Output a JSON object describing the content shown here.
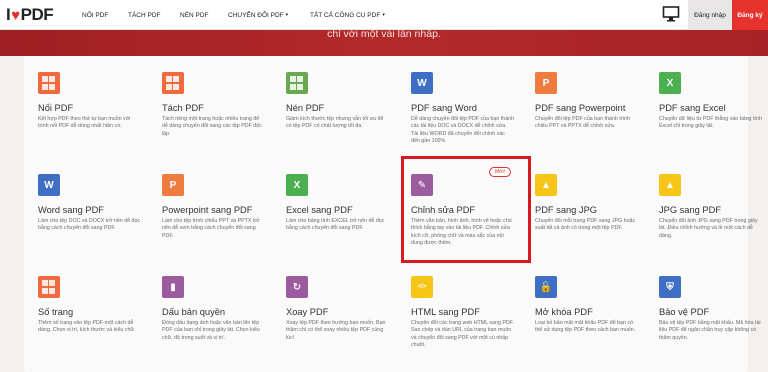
{
  "brand": {
    "logo_left": "I",
    "logo_right": "PDF",
    "accent": "#e5322d",
    "heart_icon": "heart-icon"
  },
  "nav": {
    "items": [
      "NỐI PDF",
      "TÁCH PDF",
      "NÉN PDF",
      "CHUYỂN ĐỔI PDF",
      "TẤT CẢ CÔNG CỤ PDF"
    ],
    "caret": "▾",
    "login": "Đăng nhập",
    "signup": "Đăng ký",
    "desktop_icon": "monitor-icon"
  },
  "hero": {
    "text": "chỉ với một vài lần nhấp."
  },
  "tools": [
    {
      "title": "Nối PDF",
      "desc": "Kết hợp PDF theo thứ tự bạn muốn với trình nối PDF dễ dùng nhất hiện có.",
      "color": "#f06a3e",
      "icon": "merge-icon"
    },
    {
      "title": "Tách PDF",
      "desc": "Tách riêng một trang hoặc nhiều trang để dễ dàng chuyển đổi sang các tệp PDF độc lập.",
      "color": "#f06a3e",
      "icon": "split-icon"
    },
    {
      "title": "Nén PDF",
      "desc": "Giảm kích thước tệp nhưng vẫn tối ưu để có tệp PDF có chất lượng tốt đa.",
      "color": "#6aa84f",
      "icon": "compress-icon"
    },
    {
      "title": "PDF sang Word",
      "desc": "Dễ dàng chuyển đổi tệp PDF của bạn thành các tài liệu DOC và DOCX dễ chỉnh sửa. Tài liệu WORD đã chuyển đổi chính xác đến gần 100%.",
      "color": "#3f6fc4",
      "icon": "word-icon"
    },
    {
      "title": "PDF sang Powerpoint",
      "desc": "Chuyển đổi tệp PDF của bạn thành trình chiếu PPT và PPTX dễ chỉnh sửa.",
      "color": "#ef7c3f",
      "icon": "powerpoint-icon"
    },
    {
      "title": "PDF sang Excel",
      "desc": "Chuyển dữ liệu từ PDF thẳng vào bảng tính Excel chỉ trong giây lát.",
      "color": "#4caf50",
      "icon": "excel-icon"
    },
    {
      "title": "Word sang PDF",
      "desc": "Làm cho tệp DOC và DOCX trở nên dễ đọc bằng cách chuyển đổi sang PDF.",
      "color": "#3f6fc4",
      "icon": "word-icon"
    },
    {
      "title": "Powerpoint sang PDF",
      "desc": "Làm cho tệp trình chiếu PPT và PPTX trở nên dễ xem bằng cách chuyển đổi sang PDF.",
      "color": "#ef7c3f",
      "icon": "powerpoint-icon"
    },
    {
      "title": "Excel sang PDF",
      "desc": "Làm cho bảng tính EXCEL trở nên dễ đọc bằng cách chuyển đổi sang PDF.",
      "color": "#4caf50",
      "icon": "excel-icon"
    },
    {
      "title": "Chỉnh sửa PDF",
      "desc": "Thêm văn bản, hình ảnh, hình vẽ hoặc chú thích bằng tay vào tài liệu PDF. Chỉnh sửa kích cỡ, phông chữ và màu sắc của nội dung được thêm.",
      "color": "#9c5a9f",
      "icon": "edit-icon",
      "badge": "Mới!"
    },
    {
      "title": "PDF sang JPG",
      "desc": "Chuyển đổi mỗi trang PDF sang JPG hoặc xuất tất cả ảnh có trong một tệp PDF.",
      "color": "#f5c518",
      "icon": "image-icon"
    },
    {
      "title": "JPG sang PDF",
      "desc": "Chuyển đổi ảnh JPG sang PDF trong giây lát. Điều chỉnh hướng và lề một cách dễ dàng.",
      "color": "#f5c518",
      "icon": "image-icon"
    },
    {
      "title": "Số trang",
      "desc": "Thêm số trang vào tệp PDF một cách dễ dàng. Chọn vị trí, kích thước và kiểu chữ.",
      "color": "#f06a3e",
      "icon": "page-numbers-icon"
    },
    {
      "title": "Dấu bản quyền",
      "desc": "Đóng dấu dạng ảnh hoặc văn bản lên tệp PDF của bạn chỉ trong giây lát. Chọn kiểu chữ, độ trong suốt và vị trí.",
      "color": "#9c5a9f",
      "icon": "stamp-icon"
    },
    {
      "title": "Xoay PDF",
      "desc": "Xoay tệp PDF theo hướng bạn muốn. Bạn thậm chí có thể xoay nhiều tệp PDF cùng lúc!",
      "color": "#9c5a9f",
      "icon": "rotate-icon"
    },
    {
      "title": "HTML sang PDF",
      "desc": "Chuyển đổi các trang web HTML sang PDF. Sao chép và dán URL của trang bạn muốn và chuyển đổi sang PDF với một cú nhấp chuột.",
      "color": "#f5c518",
      "icon": "html-icon"
    },
    {
      "title": "Mở khóa PDF",
      "desc": "Loại bỏ bảo mật mật khẩu PDF để bạn có thể sử dụng tệp PDF theo cách bạn muốn.",
      "color": "#3f6fc4",
      "icon": "unlock-icon"
    },
    {
      "title": "Bảo vệ PDF",
      "desc": "Bảo vệ tệp PDF bằng mật khẩu. Mã hóa tài liệu PDF để ngăn chặn truy cập không có thẩm quyền.",
      "color": "#3f6fc4",
      "icon": "shield-icon"
    }
  ]
}
